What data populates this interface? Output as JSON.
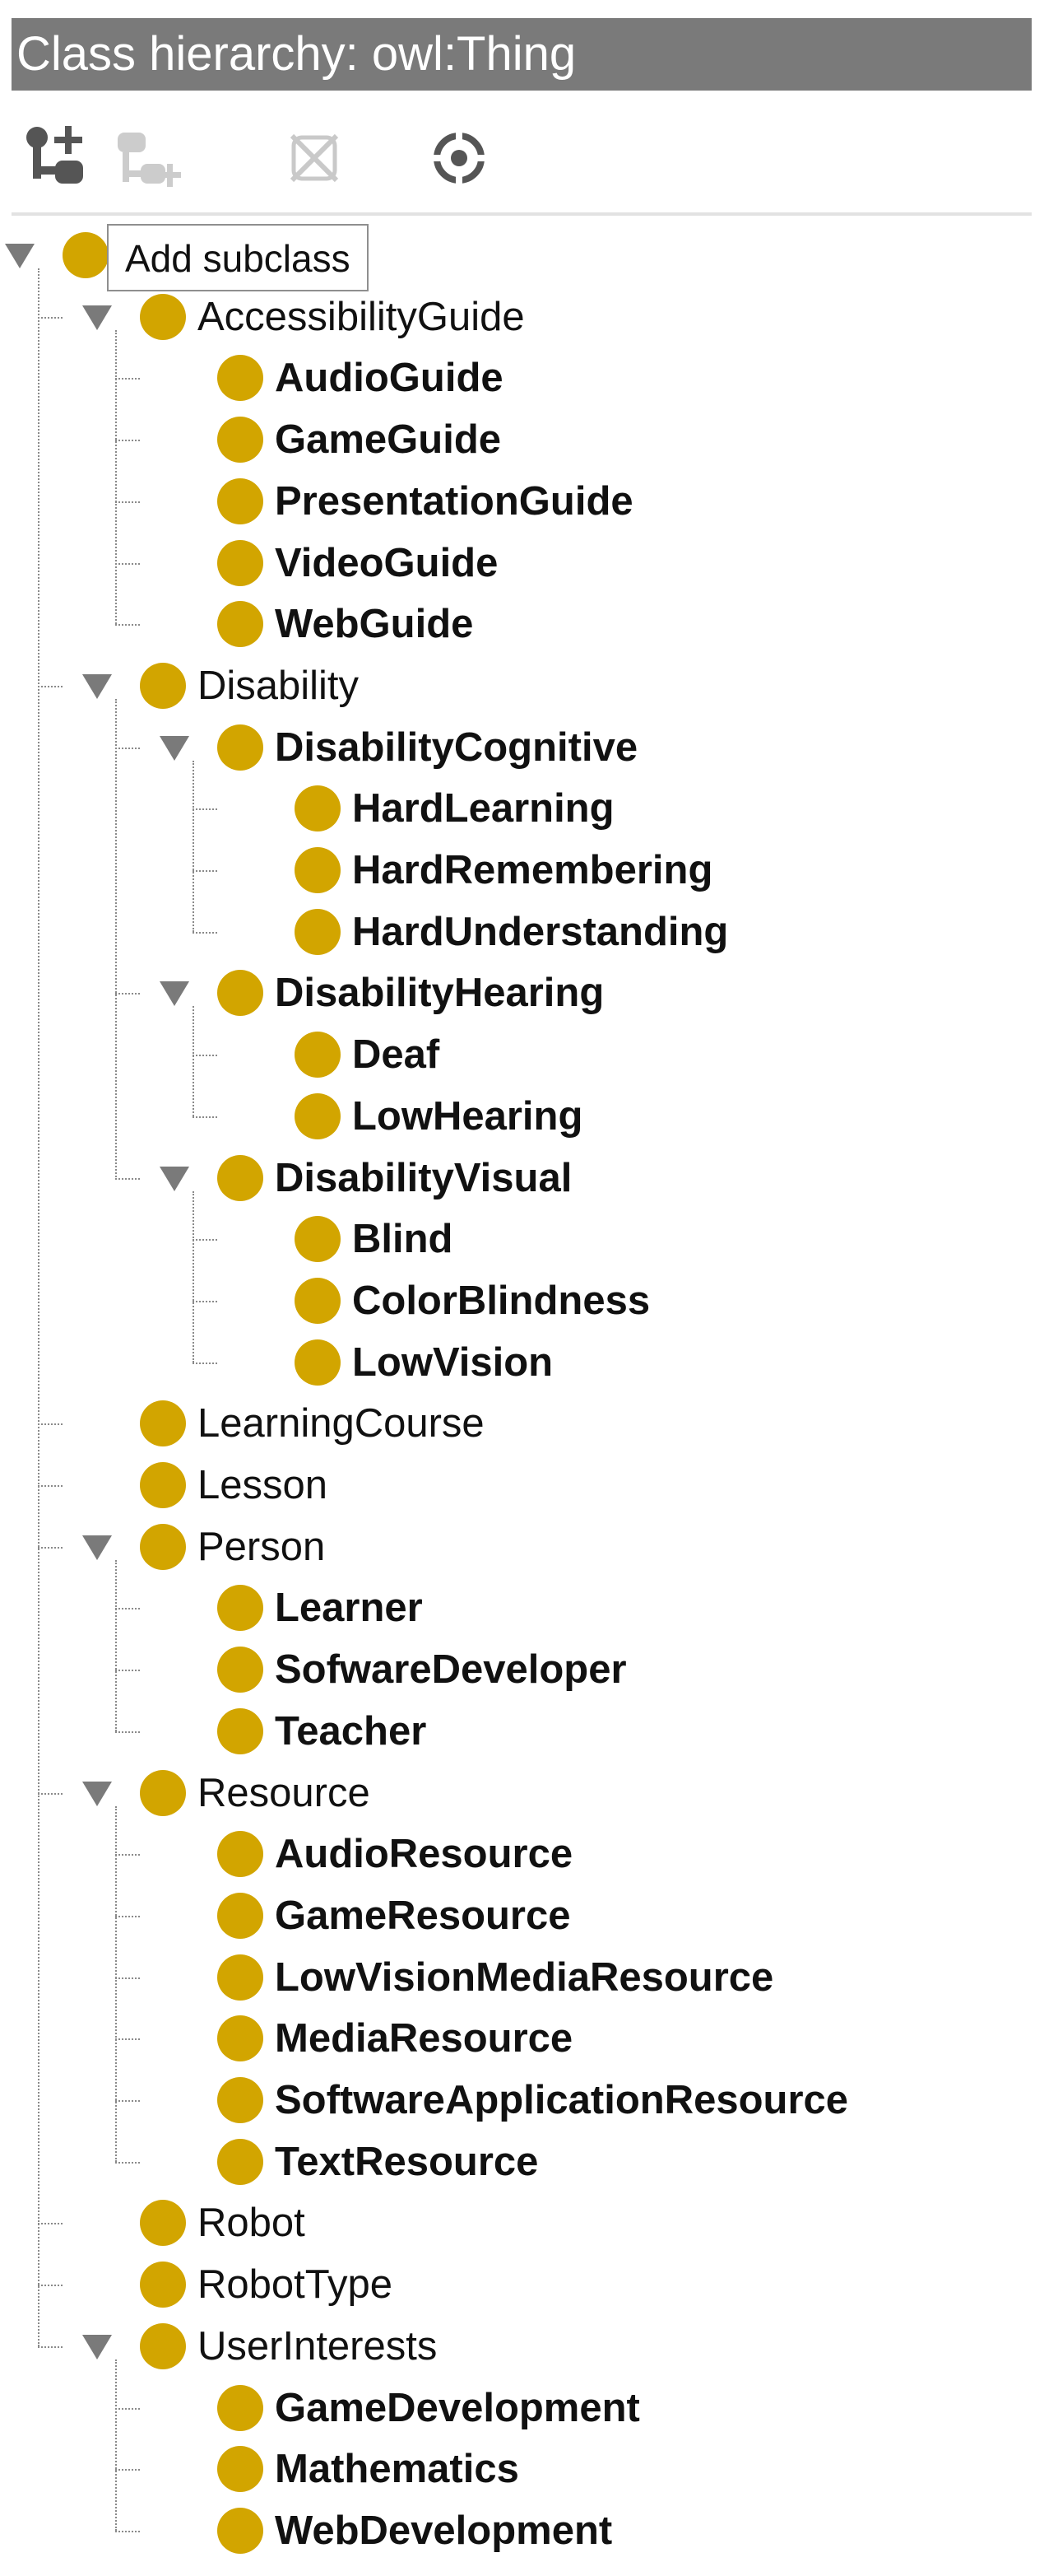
{
  "panel": {
    "title": "Class hierarchy: owl:Thing"
  },
  "toolbar": {
    "add_subclass_icon": "add-subclass-icon",
    "add_sibling_icon": "add-sibling-icon",
    "delete_icon": "delete-class-icon",
    "find_icon": "find-icon"
  },
  "tooltip": {
    "text": "Add subclass"
  },
  "tree": {
    "root": {
      "label": "owl:Thing"
    },
    "nodes": [
      {
        "label": "AccessibilityGuide",
        "level": 1,
        "expanded": true
      },
      {
        "label": "AudioGuide",
        "level": 2
      },
      {
        "label": "GameGuide",
        "level": 2
      },
      {
        "label": "PresentationGuide",
        "level": 2
      },
      {
        "label": "VideoGuide",
        "level": 2
      },
      {
        "label": "WebGuide",
        "level": 2
      },
      {
        "label": "Disability",
        "level": 1,
        "expanded": true
      },
      {
        "label": "DisabilityCognitive",
        "level": 2,
        "expanded": true
      },
      {
        "label": "HardLearning",
        "level": 3
      },
      {
        "label": "HardRemembering",
        "level": 3
      },
      {
        "label": "HardUnderstanding",
        "level": 3
      },
      {
        "label": "DisabilityHearing",
        "level": 2,
        "expanded": true
      },
      {
        "label": "Deaf",
        "level": 3
      },
      {
        "label": "LowHearing",
        "level": 3
      },
      {
        "label": "DisabilityVisual",
        "level": 2,
        "expanded": true
      },
      {
        "label": "Blind",
        "level": 3
      },
      {
        "label": "ColorBlindness",
        "level": 3
      },
      {
        "label": "LowVision",
        "level": 3
      },
      {
        "label": "LearningCourse",
        "level": 1
      },
      {
        "label": "Lesson",
        "level": 1
      },
      {
        "label": "Person",
        "level": 1,
        "expanded": true
      },
      {
        "label": "Learner",
        "level": 2
      },
      {
        "label": "SofwareDeveloper",
        "level": 2
      },
      {
        "label": "Teacher",
        "level": 2
      },
      {
        "label": "Resource",
        "level": 1,
        "expanded": true
      },
      {
        "label": "AudioResource",
        "level": 2
      },
      {
        "label": "GameResource",
        "level": 2
      },
      {
        "label": "LowVisionMediaResource",
        "level": 2
      },
      {
        "label": "MediaResource",
        "level": 2
      },
      {
        "label": "SoftwareApplicationResource",
        "level": 2
      },
      {
        "label": "TextResource",
        "level": 2
      },
      {
        "label": "Robot",
        "level": 1
      },
      {
        "label": "RobotType",
        "level": 1
      },
      {
        "label": "UserInterests",
        "level": 1,
        "expanded": true
      },
      {
        "label": "GameDevelopment",
        "level": 2
      },
      {
        "label": "Mathematics",
        "level": 2
      },
      {
        "label": "WebDevelopment",
        "level": 2
      }
    ]
  },
  "colors": {
    "title_bar": "#7a7a7a",
    "class_node": "#d2a500",
    "toggle": "#7a7a7a",
    "connector": "#8a8a8a"
  }
}
